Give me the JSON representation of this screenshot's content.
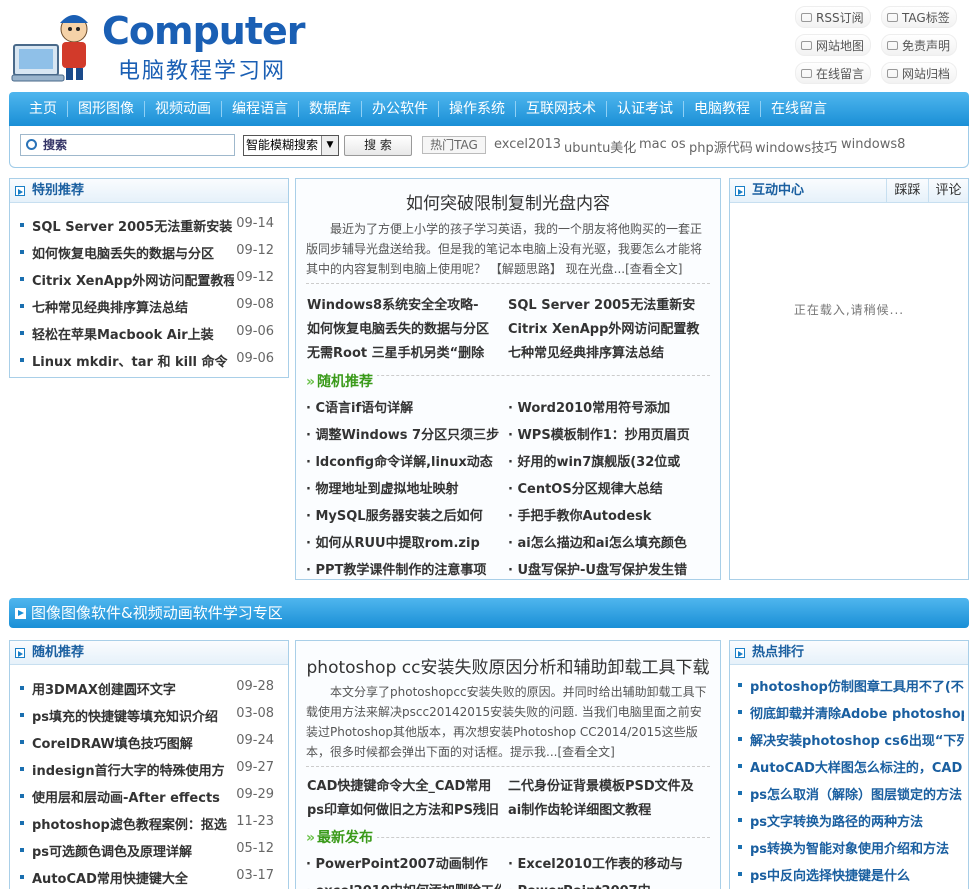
{
  "logo": {
    "title": "Computer",
    "subtitle": "电脑教程学习网"
  },
  "toplinks": [
    "RSS订阅",
    "TAG标签",
    "网站地图",
    "免责声明",
    "在线留言",
    "网站归档"
  ],
  "nav": [
    "主页",
    "图形图像",
    "视频动画",
    "编程语言",
    "数据库",
    "办公软件",
    "操作系统",
    "互联网技术",
    "认证考试",
    "电脑教程",
    "在线留言"
  ],
  "search": {
    "placeholder": "搜索",
    "mode": "智能模糊搜索",
    "button": "搜 索",
    "tag_label": "热门TAG",
    "tags": [
      "excel2013",
      "ubuntu美化",
      "mac os",
      "php源代码",
      "windows技巧",
      "windows8"
    ]
  },
  "featured": {
    "title": "特别推荐",
    "items": [
      {
        "text": "SQL Server 2005无法重新安装",
        "date": "09-14"
      },
      {
        "text": "如何恢复电脑丢失的数据与分区",
        "date": "09-12"
      },
      {
        "text": "Citrix XenApp外网访问配置教程",
        "date": "09-12"
      },
      {
        "text": "七种常见经典排序算法总结",
        "date": "09-08"
      },
      {
        "text": "轻松在苹果Macbook Air上装",
        "date": "09-06"
      },
      {
        "text": "Linux mkdir、tar 和 kill 命令",
        "date": "09-06"
      }
    ]
  },
  "headline": {
    "title": "如何突破限制复制光盘内容",
    "summary": "最近为了方便上小学的孩子学习英语，我的一个朋友将他购买的一套正版同步辅导光盘送给我。但是我的笔记本电脑上没有光驱，我要怎么才能将其中的内容复制到电脑上使用呢？ 【解题思路】 现在光盘...[查看全文]",
    "links": [
      "Windows8系统安全全攻略-",
      "SQL Server 2005无法重新安",
      "如何恢复电脑丢失的数据与分区",
      "Citrix XenApp外网访问配置教",
      "无需Root 三星手机另类“删除",
      "七种常见经典排序算法总结"
    ],
    "random_title": "随机推荐",
    "random": [
      "C语言if语句详解",
      "Word2010常用符号添加",
      "调整Windows 7分区只须三步",
      "WPS模板制作1：抄用页眉页",
      "ldconfig命令详解,linux动态",
      "好用的win7旗舰版(32位或",
      "物理地址到虚拟地址映射",
      "CentOS分区规律大总结",
      "MySQL服务器安装之后如何",
      "手把手教你Autodesk",
      "如何从RUU中提取rom.zip",
      "ai怎么描边和ai怎么填充颜色",
      "PPT教学课件制作的注意事项",
      "U盘写保护-U盘写保护发生错"
    ]
  },
  "interact": {
    "title": "互动中心",
    "tab1": "踩踩",
    "tab2": "评论",
    "loading": "正在载入,请稍候..."
  },
  "zone": {
    "title": "图像图像软件&视频动画软件学习专区"
  },
  "random2": {
    "title": "随机推荐",
    "items": [
      {
        "text": "用3DMAX创建圆环文字",
        "date": "09-28"
      },
      {
        "text": "ps填充的快捷键等填充知识介绍",
        "date": "03-08"
      },
      {
        "text": "CorelDRAW填色技巧图解",
        "date": "09-24"
      },
      {
        "text": "indesign首行大字的特殊使用方",
        "date": "09-27"
      },
      {
        "text": "使用层和层动画-After effects",
        "date": "09-29"
      },
      {
        "text": "photoshop滤色教程案例：抠选",
        "date": "11-23"
      },
      {
        "text": "ps可选颜色调色及原理详解",
        "date": "05-12"
      },
      {
        "text": "AutoCAD常用快捷键大全",
        "date": "03-17"
      }
    ]
  },
  "headline2": {
    "title": "photoshop cc安装失败原因分析和辅助卸载工具下载",
    "summary": "本文分享了photoshopcc安装失败的原因。并同时给出辅助卸载工具下载使用方法来解决pscc20142015安装失败的问题. 当我们电脑里面之前安装过Photoshop其他版本，再次想安装Photoshop CC2014/2015这些版本，很多时候都会弹出下面的对话框。提示我...[查看全文]",
    "links": [
      "CAD快捷键命令大全_CAD常用",
      "二代身份证背景模板PSD文件及",
      "ps印章如何做旧之方法和PS残旧",
      "ai制作齿轮详细图文教程"
    ],
    "latest_title": "最新发布",
    "latest": [
      "PowerPoint2007动画制作",
      "Excel2010工作表的移动与",
      "excel2010中如何添加删除工作",
      "PowerPoint2007中"
    ]
  },
  "hot": {
    "title": "热点排行",
    "items": [
      "photoshop仿制图章工具用不了(不",
      "彻底卸载并清除Adobe photoshop",
      "解决安装photoshop cs6出现“下列",
      "AutoCAD大样图怎么标注的，CAD",
      "ps怎么取消（解除）图层锁定的方法",
      "ps文字转换为路径的两种方法",
      "ps转换为智能对象使用介绍和方法",
      "ps中反向选择快捷键是什么"
    ]
  }
}
